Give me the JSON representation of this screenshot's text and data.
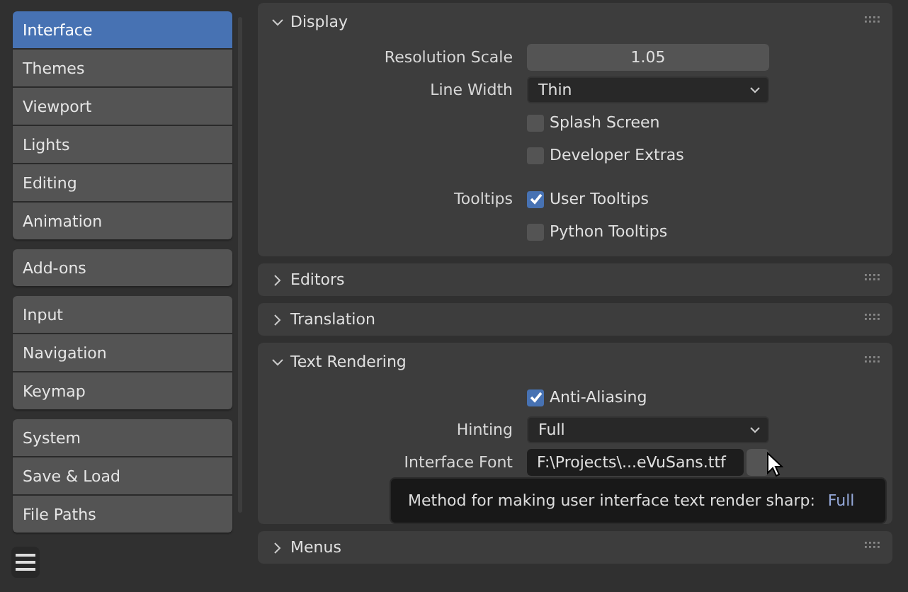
{
  "sidebar": {
    "groups": [
      [
        {
          "label": "Interface",
          "selected": true
        },
        {
          "label": "Themes",
          "selected": false
        },
        {
          "label": "Viewport",
          "selected": false
        },
        {
          "label": "Lights",
          "selected": false
        },
        {
          "label": "Editing",
          "selected": false
        },
        {
          "label": "Animation",
          "selected": false
        }
      ],
      [
        {
          "label": "Add-ons",
          "selected": false
        }
      ],
      [
        {
          "label": "Input",
          "selected": false
        },
        {
          "label": "Navigation",
          "selected": false
        },
        {
          "label": "Keymap",
          "selected": false
        }
      ],
      [
        {
          "label": "System",
          "selected": false
        },
        {
          "label": "Save & Load",
          "selected": false
        },
        {
          "label": "File Paths",
          "selected": false
        }
      ]
    ]
  },
  "panels": [
    {
      "title": "Display",
      "expanded": true,
      "rows": [
        {
          "kind": "number",
          "label": "Resolution Scale",
          "value": "1.05"
        },
        {
          "kind": "dropdown",
          "label": "Line Width",
          "value": "Thin"
        },
        {
          "kind": "checkbox",
          "text": "Splash Screen",
          "checked": false
        },
        {
          "kind": "checkbox",
          "text": "Developer Extras",
          "checked": false
        },
        {
          "kind": "checkbox",
          "label": "Tooltips",
          "text": "User Tooltips",
          "checked": true
        },
        {
          "kind": "checkbox",
          "text": "Python Tooltips",
          "checked": false
        }
      ]
    },
    {
      "title": "Editors",
      "expanded": false
    },
    {
      "title": "Translation",
      "expanded": false
    },
    {
      "title": "Text Rendering",
      "expanded": true,
      "rows": [
        {
          "kind": "checkbox",
          "text": "Anti-Aliasing",
          "checked": true
        },
        {
          "kind": "dropdown",
          "label": "Hinting",
          "value": "Full"
        },
        {
          "kind": "file",
          "label": "Interface Font",
          "value": "F:\\Projects\\...eVuSans.ttf"
        }
      ],
      "tooltip": {
        "text": "Method for making user interface text render sharp:",
        "value": "Full"
      }
    },
    {
      "title": "Menus",
      "expanded": false
    }
  ]
}
